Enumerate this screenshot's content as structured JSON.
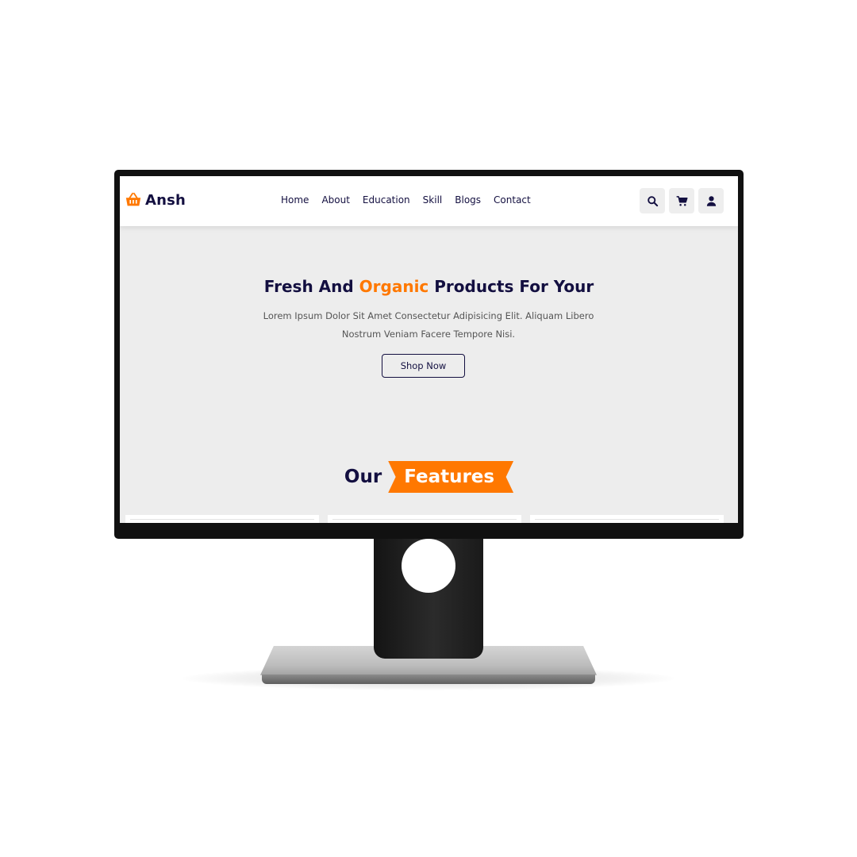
{
  "brand": {
    "name": "Ansh",
    "logo_icon": "basket-icon",
    "accent_color": "#ff7800",
    "primary_color": "#130f40"
  },
  "nav": {
    "links": [
      {
        "label": "Home"
      },
      {
        "label": "About"
      },
      {
        "label": "Education"
      },
      {
        "label": "Skill"
      },
      {
        "label": "Blogs"
      },
      {
        "label": "Contact"
      }
    ],
    "icons": [
      "search-icon",
      "cart-icon",
      "user-icon"
    ]
  },
  "hero": {
    "title_part1": "Fresh And ",
    "title_accent": "Organic",
    "title_part2": " Products For Your",
    "description": "Lorem Ipsum Dolor Sit Amet Consectetur Adipisicing Elit. Aliquam Libero Nostrum Veniam Facere Tempore Nisi.",
    "cta_label": "Shop Now"
  },
  "features": {
    "heading_plain": "Our",
    "heading_tag": "Features"
  }
}
